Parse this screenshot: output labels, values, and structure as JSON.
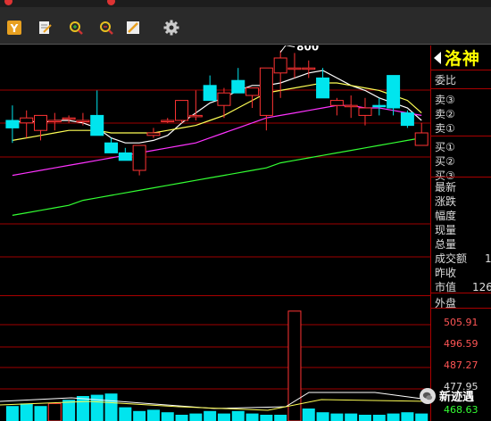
{
  "toolbar": {
    "buttons": [
      {
        "icon": "y-square-icon"
      },
      {
        "icon": "edit-document-icon"
      },
      {
        "icon": "zoom-in-icon"
      },
      {
        "icon": "zoom-out-icon"
      },
      {
        "icon": "pencil-draw-icon"
      },
      {
        "icon": "gear-icon"
      }
    ]
  },
  "chart": {
    "annotation_peak": "800",
    "colors": {
      "up": "#ff3333",
      "down": "#00e5ee",
      "ma5": "#ffffff",
      "ma10": "#ffff55",
      "ma20": "#ff33ff",
      "ma60": "#33ff33",
      "grid": "#a00000"
    }
  },
  "chart_data": {
    "type": "candlestick",
    "candles": [
      {
        "o": 0.3,
        "h": 0.24,
        "l": 0.39,
        "c": 0.33,
        "up": false
      },
      {
        "o": 0.31,
        "h": 0.26,
        "l": 0.37,
        "c": 0.29,
        "up": true
      },
      {
        "o": 0.34,
        "h": 0.28,
        "l": 0.38,
        "c": 0.28,
        "up": true
      },
      {
        "o": 0.3,
        "h": 0.27,
        "l": 0.34,
        "c": 0.3,
        "up": true
      },
      {
        "o": 0.29,
        "h": 0.28,
        "l": 0.31,
        "c": 0.29,
        "up": true
      },
      {
        "o": 0.3,
        "h": 0.27,
        "l": 0.32,
        "c": 0.3,
        "up": true
      },
      {
        "o": 0.28,
        "h": 0.18,
        "l": 0.33,
        "c": 0.36,
        "up": false
      },
      {
        "o": 0.39,
        "h": 0.37,
        "l": 0.43,
        "c": 0.43,
        "up": false
      },
      {
        "o": 0.43,
        "h": 0.41,
        "l": 0.45,
        "c": 0.46,
        "up": false
      },
      {
        "o": 0.5,
        "h": 0.4,
        "l": 0.52,
        "c": 0.4,
        "up": true
      },
      {
        "o": 0.36,
        "h": 0.33,
        "l": 0.37,
        "c": 0.35,
        "up": true
      },
      {
        "o": 0.3,
        "h": 0.29,
        "l": 0.31,
        "c": 0.3,
        "up": true
      },
      {
        "o": 0.3,
        "h": 0.22,
        "l": 0.31,
        "c": 0.22,
        "up": true
      },
      {
        "o": 0.28,
        "h": 0.18,
        "l": 0.3,
        "c": 0.28,
        "up": true
      },
      {
        "o": 0.16,
        "h": 0.12,
        "l": 0.2,
        "c": 0.22,
        "up": false
      },
      {
        "o": 0.24,
        "h": 0.17,
        "l": 0.29,
        "c": 0.19,
        "up": true
      },
      {
        "o": 0.14,
        "h": 0.09,
        "l": 0.18,
        "c": 0.19,
        "up": false
      },
      {
        "o": 0.2,
        "h": 0.2,
        "l": 0.25,
        "c": 0.17,
        "up": true
      },
      {
        "o": 0.28,
        "h": 0.17,
        "l": 0.34,
        "c": 0.09,
        "up": true
      },
      {
        "o": 0.11,
        "h": 0.02,
        "l": 0.21,
        "c": 0.05,
        "up": true
      },
      {
        "o": 0.09,
        "h": 0.03,
        "l": 0.13,
        "c": 0.09,
        "up": true
      },
      {
        "o": 0.09,
        "h": 0.06,
        "l": 0.13,
        "c": 0.09,
        "up": true
      },
      {
        "o": 0.13,
        "h": 0.09,
        "l": 0.2,
        "c": 0.21,
        "up": false
      },
      {
        "o": 0.24,
        "h": 0.21,
        "l": 0.28,
        "c": 0.22,
        "up": true
      },
      {
        "o": 0.24,
        "h": 0.2,
        "l": 0.29,
        "c": 0.24,
        "up": true
      },
      {
        "o": 0.28,
        "h": 0.21,
        "l": 0.32,
        "c": 0.25,
        "up": true
      },
      {
        "o": 0.24,
        "h": 0.21,
        "l": 0.28,
        "c": 0.24,
        "up": false
      },
      {
        "o": 0.12,
        "h": 0.12,
        "l": 0.28,
        "c": 0.25,
        "up": false
      },
      {
        "o": 0.27,
        "h": 0.26,
        "l": 0.33,
        "c": 0.32,
        "up": false
      },
      {
        "o": 0.35,
        "h": 0.31,
        "l": 0.4,
        "c": 0.4,
        "up": true
      }
    ],
    "ma": [
      {
        "name": "MA5",
        "values": [
          0.31,
          0.3,
          0.31,
          0.3,
          0.3,
          0.31,
          0.33,
          0.37,
          0.39,
          0.39,
          0.38,
          0.36,
          0.31,
          0.27,
          0.23,
          0.21,
          0.18,
          0.16,
          0.16,
          0.15,
          0.13,
          0.11,
          0.1,
          0.13,
          0.16,
          0.18,
          0.21,
          0.23,
          0.25,
          0.3
        ]
      },
      {
        "name": "MA10",
        "values": [
          0.38,
          0.37,
          0.36,
          0.35,
          0.34,
          0.34,
          0.34,
          0.35,
          0.35,
          0.35,
          0.35,
          0.34,
          0.33,
          0.32,
          0.3,
          0.28,
          0.25,
          0.22,
          0.19,
          0.18,
          0.17,
          0.16,
          0.15,
          0.15,
          0.16,
          0.17,
          0.18,
          0.2,
          0.22,
          0.27
        ]
      },
      {
        "name": "MA20",
        "values": [
          0.52,
          0.51,
          0.5,
          0.49,
          0.48,
          0.47,
          0.46,
          0.45,
          0.44,
          0.43,
          0.42,
          0.41,
          0.4,
          0.39,
          0.37,
          0.35,
          0.33,
          0.31,
          0.29,
          0.28,
          0.27,
          0.26,
          0.25,
          0.24,
          0.24,
          0.25,
          0.25,
          0.26,
          0.27,
          0.28
        ]
      },
      {
        "name": "MA60",
        "values": [
          0.68,
          0.67,
          0.66,
          0.65,
          0.64,
          0.62,
          0.61,
          0.6,
          0.59,
          0.58,
          0.57,
          0.56,
          0.55,
          0.54,
          0.53,
          0.52,
          0.51,
          0.5,
          0.49,
          0.47,
          0.46,
          0.45,
          0.44,
          0.43,
          0.42,
          0.41,
          0.4,
          0.39,
          0.38,
          0.37
        ]
      }
    ],
    "volume": [
      {
        "v": 0.12,
        "up": false
      },
      {
        "v": 0.14,
        "up": false
      },
      {
        "v": 0.12,
        "up": false
      },
      {
        "v": 0.14,
        "up": true
      },
      {
        "v": 0.17,
        "up": false
      },
      {
        "v": 0.2,
        "up": false
      },
      {
        "v": 0.21,
        "up": false
      },
      {
        "v": 0.22,
        "up": false
      },
      {
        "v": 0.11,
        "up": false
      },
      {
        "v": 0.08,
        "up": false
      },
      {
        "v": 0.09,
        "up": false
      },
      {
        "v": 0.07,
        "up": false
      },
      {
        "v": 0.05,
        "up": false
      },
      {
        "v": 0.06,
        "up": false
      },
      {
        "v": 0.08,
        "up": false
      },
      {
        "v": 0.06,
        "up": false
      },
      {
        "v": 0.08,
        "up": false
      },
      {
        "v": 0.06,
        "up": false
      },
      {
        "v": 0.05,
        "up": false
      },
      {
        "v": 0.05,
        "up": false
      },
      {
        "v": 0.88,
        "up": true
      },
      {
        "v": 0.1,
        "up": false
      },
      {
        "v": 0.07,
        "up": false
      },
      {
        "v": 0.06,
        "up": false
      },
      {
        "v": 0.06,
        "up": false
      },
      {
        "v": 0.05,
        "up": false
      },
      {
        "v": 0.05,
        "up": false
      },
      {
        "v": 0.06,
        "up": false
      },
      {
        "v": 0.07,
        "up": false
      },
      {
        "v": 0.06,
        "up": false
      }
    ],
    "volume_axis": [
      "505.91",
      "496.59",
      "487.27",
      "477.95",
      "468.63"
    ]
  },
  "panel": {
    "stock_name": "洛神",
    "labels": [
      "委比",
      "卖③",
      "卖②",
      "卖①",
      "买①",
      "买②",
      "买③",
      "最新",
      "涨跌",
      "幅度",
      "现量",
      "总量",
      "成交额",
      "昨收",
      "市值",
      "外盘"
    ],
    "values": {
      "turnover": "1",
      "market_cap": "126"
    }
  },
  "watermark": {
    "text": "新迹遇"
  }
}
